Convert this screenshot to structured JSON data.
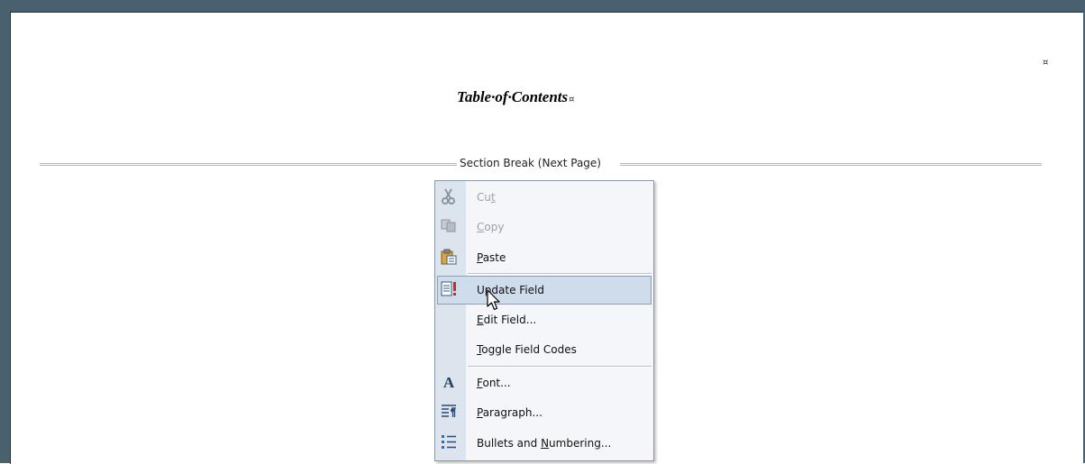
{
  "document": {
    "title": "Table·of·Contents",
    "title_mark": "¤",
    "corner_mark": "¤",
    "section_break": "Section Break (Next Page)"
  },
  "context_menu": {
    "items": [
      {
        "pre": "Cu",
        "key": "t",
        "post": "",
        "icon": "scissors-icon",
        "disabled": true
      },
      {
        "pre": "",
        "key": "C",
        "post": "opy",
        "icon": "copy-icon",
        "disabled": true
      },
      {
        "pre": "",
        "key": "P",
        "post": "aste",
        "icon": "paste-icon",
        "disabled": false
      },
      {
        "pre": "U",
        "key": "p",
        "post": "date Field",
        "icon": "update-field-icon",
        "disabled": false,
        "highlighted": true
      },
      {
        "pre": "",
        "key": "E",
        "post": "dit Field...",
        "icon": "",
        "disabled": false
      },
      {
        "pre": "",
        "key": "T",
        "post": "oggle Field Codes",
        "icon": "",
        "disabled": false
      },
      {
        "pre": "",
        "key": "F",
        "post": "ont...",
        "icon": "font-icon",
        "disabled": false
      },
      {
        "pre": "",
        "key": "P",
        "post": "aragraph...",
        "icon": "paragraph-icon",
        "disabled": false
      },
      {
        "pre": "Bullets and ",
        "key": "N",
        "post": "umbering...",
        "icon": "bullets-icon",
        "disabled": false
      }
    ]
  },
  "colors": {
    "frame": "#49606e",
    "menu_gutter": "#dce5ee",
    "highlight": "#cfdceb"
  }
}
